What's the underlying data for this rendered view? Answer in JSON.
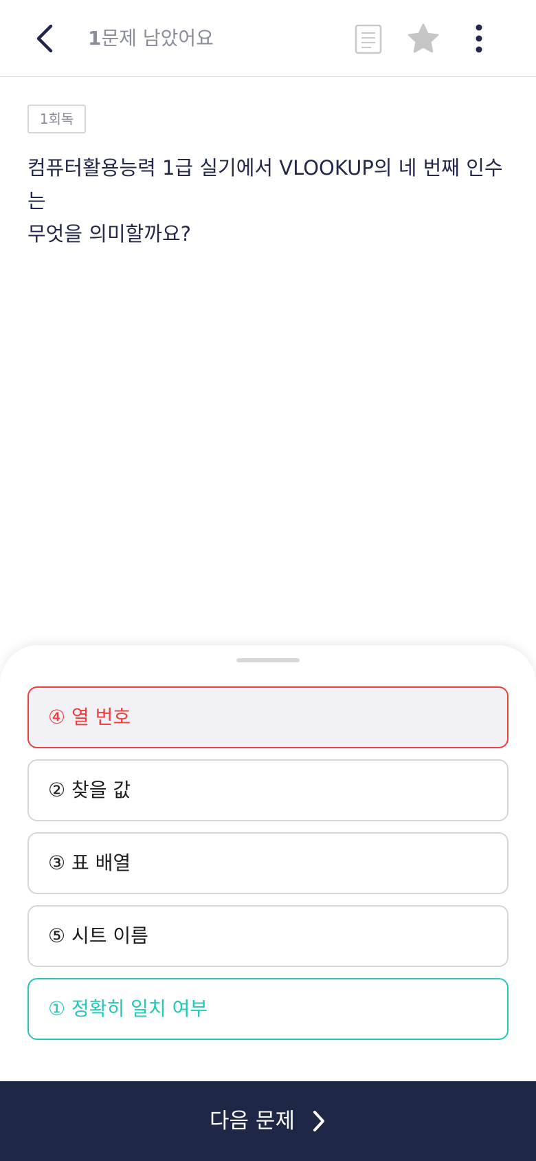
{
  "header": {
    "remaining_count": "1",
    "remaining_text": "문제 남았어요",
    "icons": [
      "back-icon",
      "note-icon",
      "star-icon",
      "more-icon"
    ]
  },
  "round_badge": "1회독",
  "question": {
    "line1": "컴퓨터활용능력 1급 실기에서 VLOOKUP의 네 번째 인수는",
    "line2": "무엇을 의미할까요?"
  },
  "options": [
    {
      "label": "④ 열 번호",
      "state": "wrong"
    },
    {
      "label": "② 찾을 값",
      "state": "normal"
    },
    {
      "label": "③ 표 배열",
      "state": "normal"
    },
    {
      "label": "⑤ 시트 이름",
      "state": "normal"
    },
    {
      "label": "① 정확히 일치 여부",
      "state": "correct"
    }
  ],
  "next_button": {
    "label": "다음 문제",
    "icon": "chevron-right-icon"
  },
  "colors": {
    "wrong": "#ef3e3e",
    "correct": "#23c8b6",
    "primary_dark": "#1f2746",
    "muted_text": "#8a8d99"
  }
}
